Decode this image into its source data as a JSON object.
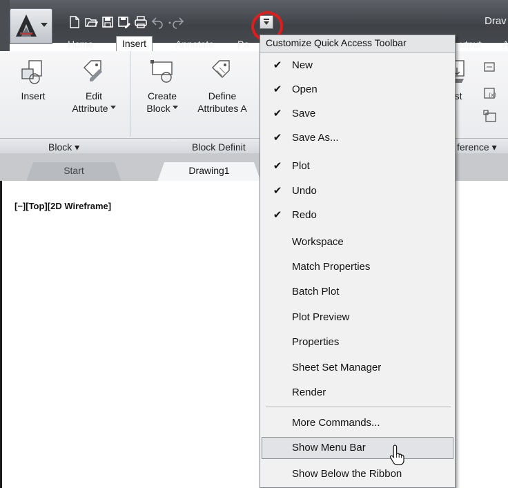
{
  "titlebar": {
    "doc_title": "Drav",
    "qat_icons": [
      "new-icon",
      "open-icon",
      "save-icon",
      "save-as-icon",
      "plot-icon",
      "undo-icon",
      "redo-icon"
    ]
  },
  "ribbon_tabs": [
    "Home",
    "Insert",
    "Annotate",
    "Pa",
    "utput",
    "A"
  ],
  "ribbon": {
    "insert_label": "Insert",
    "edit_label_1": "Edit",
    "edit_label_2": "Attribute",
    "create_label_1": "Create",
    "create_label_2": "Block",
    "define_label_1": "Define",
    "define_label_2": "Attributes",
    "define_trailing": "A",
    "adjust_label": "djust",
    "panel_block": "Block ▾",
    "panel_block_def": "Block Definit",
    "panel_reference": "ference ▾"
  },
  "file_tabs": {
    "start": "Start",
    "drawing": "Drawing1"
  },
  "viewport_label": "[−][Top][2D Wireframe]",
  "menu": {
    "header": "Customize Quick Access Toolbar",
    "items": [
      {
        "label": "New",
        "checked": "✔"
      },
      {
        "label": "Open",
        "checked": "✔"
      },
      {
        "label": "Save",
        "checked": "✔"
      },
      {
        "label": "Save As...",
        "checked": "✔"
      },
      {
        "label": "Plot",
        "checked": "✔"
      },
      {
        "label": "Undo",
        "checked": "✔"
      },
      {
        "label": "Redo",
        "checked": "✔"
      },
      {
        "label": "Workspace",
        "checked": ""
      },
      {
        "label": "Match Properties",
        "checked": ""
      },
      {
        "label": "Batch Plot",
        "checked": ""
      },
      {
        "label": "Plot Preview",
        "checked": ""
      },
      {
        "label": "Properties",
        "checked": ""
      },
      {
        "label": "Sheet Set Manager",
        "checked": ""
      },
      {
        "label": "Render",
        "checked": ""
      }
    ],
    "more_commands": "More Commands...",
    "show_menu_bar": "Show Menu Bar",
    "show_below_ribbon": "Show Below the Ribbon"
  },
  "colors": {
    "highlight_circle": "#e01c1c",
    "titlebar": "#45484d",
    "menu_bg": "#f1f1f1"
  }
}
